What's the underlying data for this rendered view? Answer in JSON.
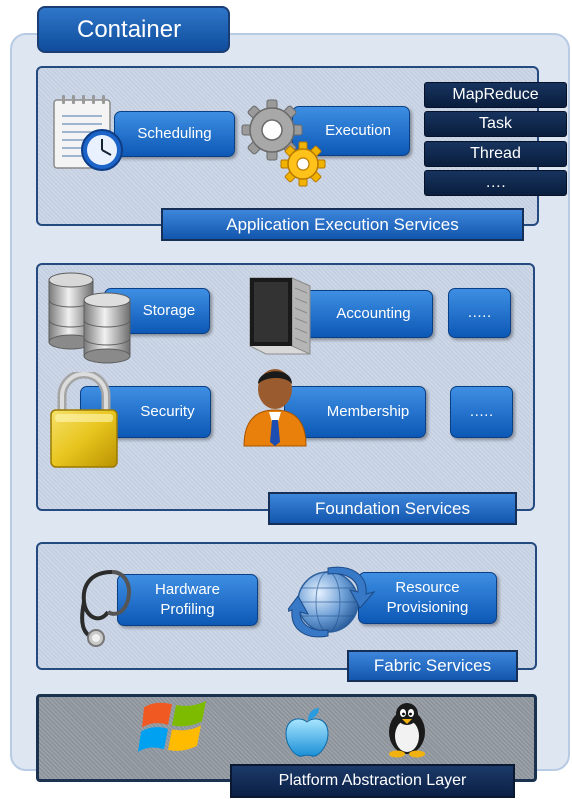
{
  "container": {
    "title": "Container"
  },
  "application": {
    "label": "Application Execution Services",
    "scheduling": "Scheduling",
    "execution": "Execution",
    "models": [
      "MapReduce",
      "Task",
      "Thread",
      "…."
    ]
  },
  "foundation": {
    "label": "Foundation Services",
    "storage": "Storage",
    "accounting": "Accounting",
    "more1": ".….",
    "security": "Security",
    "membership": "Membership",
    "more2": ".…."
  },
  "fabric": {
    "label": "Fabric Services",
    "hardware": [
      "Hardware",
      "Profiling"
    ],
    "resource": [
      "Resource",
      "Provisioning"
    ]
  },
  "platform": {
    "label": "Platform Abstraction Layer",
    "os_icons": [
      "windows-logo",
      "apple-logo",
      "linux-penguin"
    ]
  }
}
